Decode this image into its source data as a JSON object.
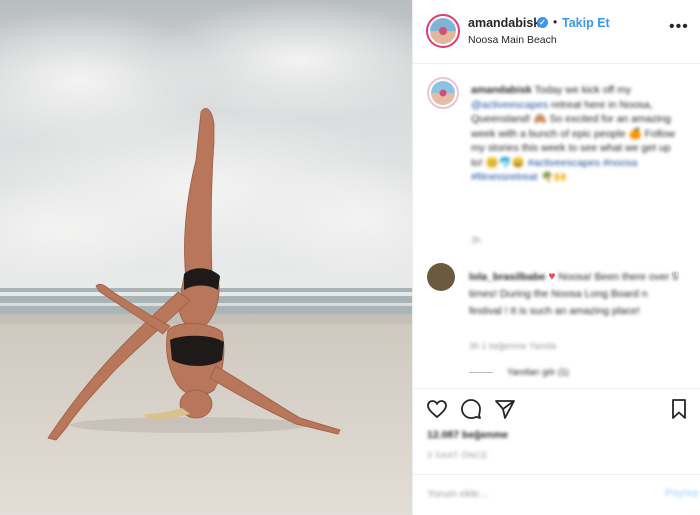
{
  "post": {
    "username": "amandabisk",
    "verified_icon": "verified-check-icon",
    "separator": "•",
    "follow_label": "Takip Et",
    "location": "Noosa Main Beach",
    "more_icon": "•••"
  },
  "caption": {
    "username": "amandabisk",
    "text_before_tag": " Today we kick off my ",
    "tag": "@activeescapes",
    "text_after_tag": " retreat here in Noosa, Queensland! 🙈 So excited for an amazing week with a bunch of epic people 🍊 Follow my stories this week to see what we get up to! 😊🐬😀 ",
    "hashtags": "#activeescapes #noosa #fitnessretreat",
    "emoji_tail": " 🌴🙌",
    "time": "3h"
  },
  "comment": {
    "username": "lola_brasilbabe",
    "heart": "♥",
    "text": " Noosa! Been there over 5 times! During the Noosa Long Board n festival ! It is such an amazing place!",
    "meta": "3h   1 beğenme   Yanıtla",
    "replies": "Yanıtları gör (1)"
  },
  "actions": {
    "likes": "12.087 beğenme",
    "date": "3 SAAT ÖNCE"
  },
  "comment_box": {
    "placeholder": "Yorum ekle...",
    "share_label": "Paylaş"
  }
}
